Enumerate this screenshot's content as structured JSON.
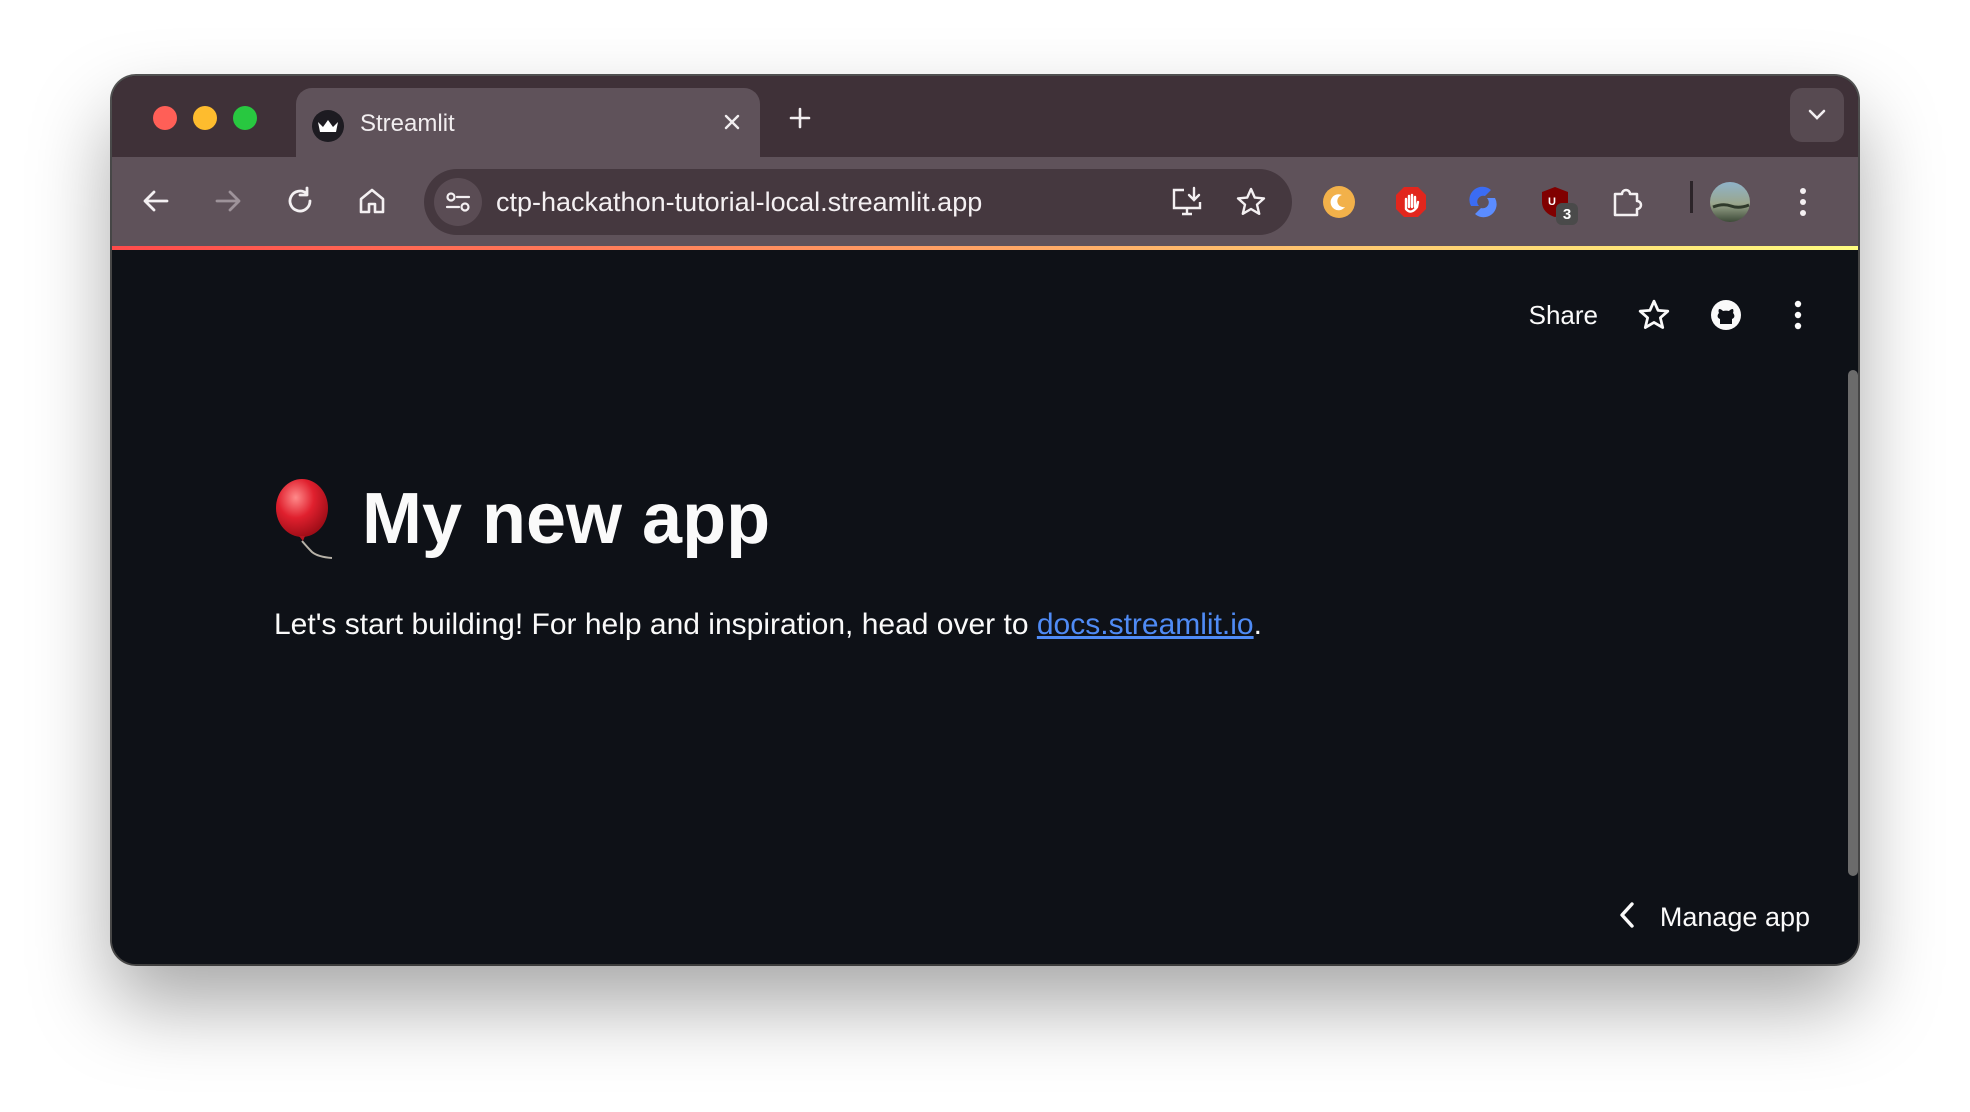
{
  "browser": {
    "tab_title": "Streamlit",
    "url": "ctp-hackathon-tutorial-local.streamlit.app",
    "extension_badge": "3"
  },
  "app": {
    "header": {
      "share_label": "Share"
    },
    "title": "My new app",
    "body_prefix": "Let's start building! For help and inspiration, head over to ",
    "link_text": "docs.streamlit.io",
    "body_suffix": ".",
    "manage_label": "Manage app"
  },
  "colors": {
    "tabbar": "#3f3138",
    "toolbar": "#5f525a",
    "app_bg": "#0e1117",
    "link": "#4f8bf5"
  },
  "icons": [
    "streamlit-crown-icon",
    "close-icon",
    "plus-icon",
    "chevron-down-icon",
    "back-arrow-icon",
    "forward-arrow-icon",
    "reload-icon",
    "home-icon",
    "site-settings-icon",
    "install-app-icon",
    "bookmark-star-icon",
    "dark-mode-extension-icon",
    "adblock-extension-icon",
    "sync-extension-icon",
    "ublock-extension-icon",
    "extensions-puzzle-icon",
    "profile-avatar-icon",
    "kebab-menu-icon",
    "star-icon",
    "github-icon",
    "balloon-icon",
    "chevron-left-icon"
  ]
}
